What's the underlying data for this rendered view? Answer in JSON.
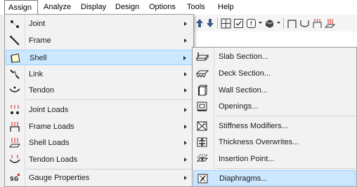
{
  "menubar": {
    "items": [
      {
        "label": "Assign",
        "active": true
      },
      {
        "label": "Analyze"
      },
      {
        "label": "Display"
      },
      {
        "label": "Design"
      },
      {
        "label": "Options"
      },
      {
        "label": "Tools"
      },
      {
        "label": "Help"
      }
    ]
  },
  "assign_menu": {
    "items": [
      {
        "label": "Joint",
        "icon": "joint-icon",
        "submenu": true
      },
      {
        "label": "Frame",
        "icon": "frame-icon",
        "submenu": true
      },
      {
        "label": "Shell",
        "icon": "shell-icon",
        "submenu": true,
        "highlighted": true
      },
      {
        "label": "Link",
        "icon": "link-icon",
        "submenu": true
      },
      {
        "label": "Tendon",
        "icon": "tendon-icon",
        "submenu": true
      },
      {
        "label": "Joint Loads",
        "icon": "joint-loads-icon",
        "submenu": true
      },
      {
        "label": "Frame Loads",
        "icon": "frame-loads-icon",
        "submenu": true
      },
      {
        "label": "Shell Loads",
        "icon": "shell-loads-icon",
        "submenu": true
      },
      {
        "label": "Tendon Loads",
        "icon": "tendon-loads-icon",
        "submenu": true
      },
      {
        "label": "Gauge Properties",
        "icon": "gauge-properties-icon",
        "icon_text": "SG",
        "submenu": true
      }
    ]
  },
  "shell_submenu": {
    "items": [
      {
        "label": "Slab Section...",
        "icon": "slab-section-icon"
      },
      {
        "label": "Deck Section...",
        "icon": "deck-section-icon"
      },
      {
        "label": "Wall Section...",
        "icon": "wall-section-icon"
      },
      {
        "label": "Openings...",
        "icon": "openings-icon"
      },
      {
        "label": "Stiffness Modifiers...",
        "icon": "stiffness-modifiers-icon"
      },
      {
        "label": "Thickness Overwrites...",
        "icon": "thickness-overwrites-icon"
      },
      {
        "label": "Insertion Point...",
        "icon": "insertion-point-icon"
      },
      {
        "label": "Diaphragms...",
        "icon": "diaphragms-icon",
        "highlighted": true
      }
    ]
  },
  "colors": {
    "highlight_fill": "#cce8ff",
    "highlight_border": "#99d1ff",
    "menu_background": "#f2f2f2",
    "load_icon_red": "#d42020"
  }
}
